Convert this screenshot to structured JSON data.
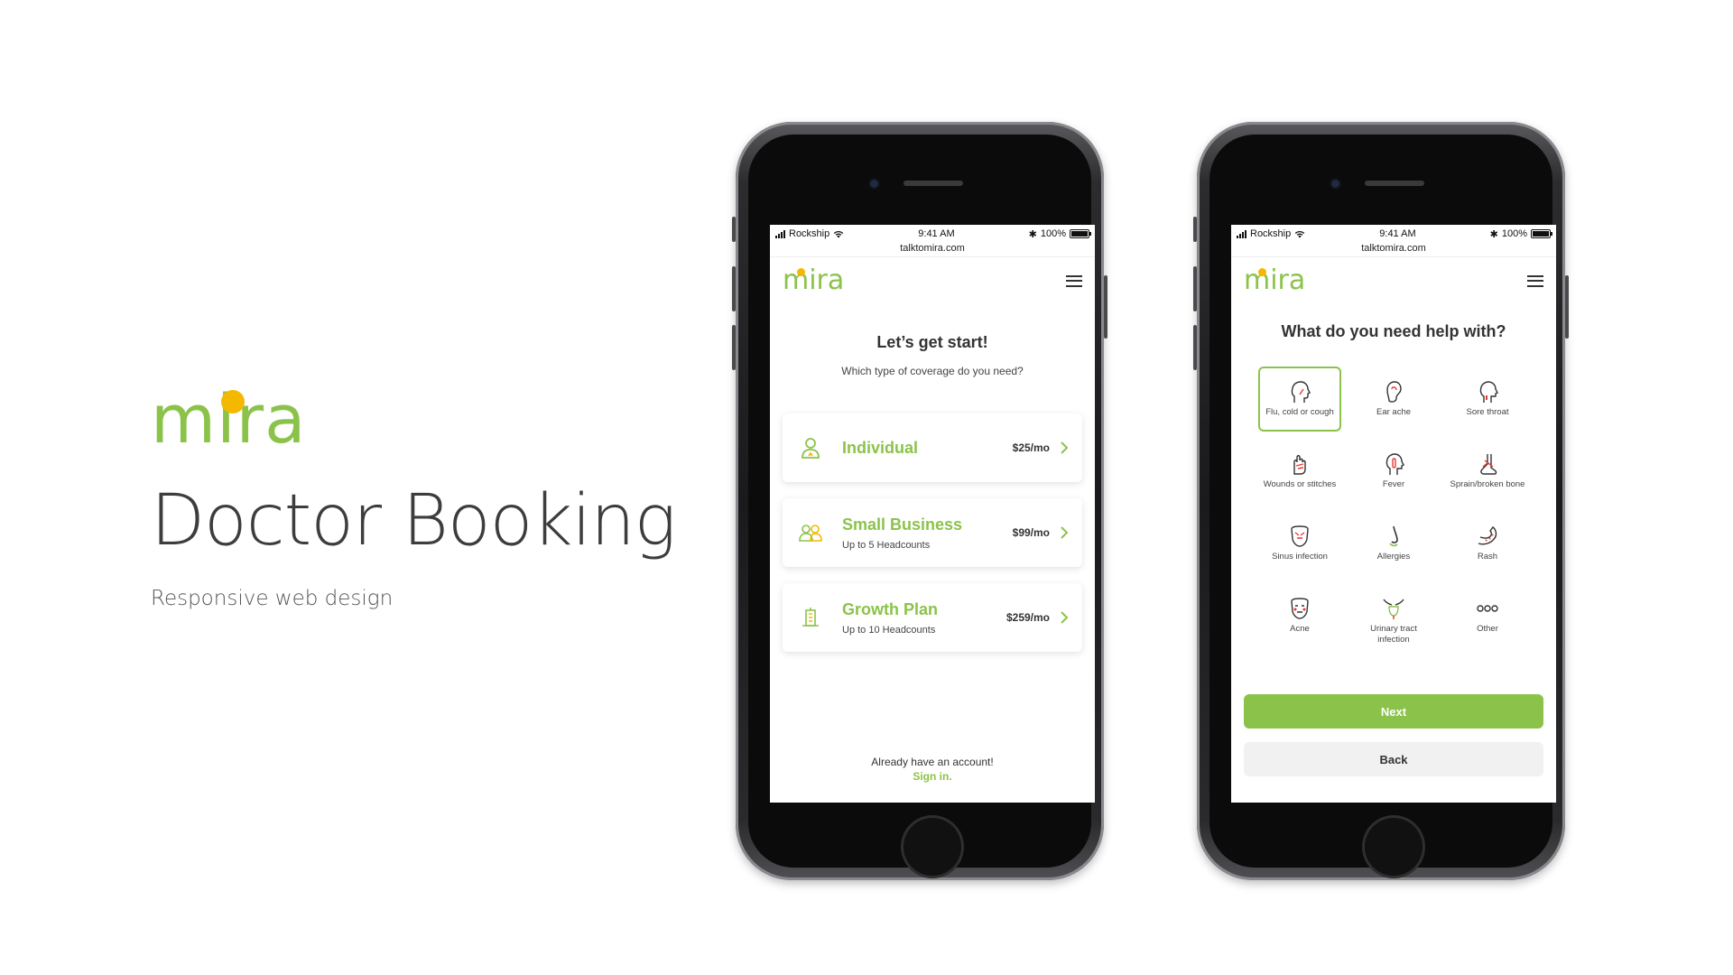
{
  "hero": {
    "logo_text": "mira",
    "title": "Doctor Booking",
    "subtitle": "Responsive web design"
  },
  "colors": {
    "brand_green": "#8bc34a",
    "brand_yellow": "#f5b800"
  },
  "status_bar": {
    "carrier": "Rockship",
    "time": "9:41 AM",
    "battery": "100%",
    "url": "talktomira.com"
  },
  "app": {
    "logo_text": "mira",
    "menu_icon": "hamburger-icon"
  },
  "screen1": {
    "title": "Let’s get start!",
    "subtitle": "Which type of coverage do you need?",
    "plans": [
      {
        "name": "Individual",
        "headcounts": "",
        "price": "$25/mo",
        "icon": "person-icon"
      },
      {
        "name": "Small Business",
        "headcounts": "Up to 5 Headcounts",
        "price": "$99/mo",
        "icon": "group-icon"
      },
      {
        "name": "Growth Plan",
        "headcounts": "Up to 10 Headcounts",
        "price": "$259/mo",
        "icon": "building-icon"
      }
    ],
    "footer_question": "Already have an account!",
    "footer_link": "Sign in."
  },
  "screen2": {
    "title": "What do you need help with?",
    "symptoms": [
      {
        "label": "Flu, cold or cough",
        "icon": "head-icon",
        "selected": true
      },
      {
        "label": "Ear ache",
        "icon": "ear-icon",
        "selected": false
      },
      {
        "label": "Sore throat",
        "icon": "throat-icon",
        "selected": false
      },
      {
        "label": "Wounds or stitches",
        "icon": "bandage-icon",
        "selected": false
      },
      {
        "label": "Fever",
        "icon": "thermometer-icon",
        "selected": false
      },
      {
        "label": "Sprain/broken bone",
        "icon": "foot-icon",
        "selected": false
      },
      {
        "label": "Sinus infection",
        "icon": "face-sinus-icon",
        "selected": false
      },
      {
        "label": "Allergies",
        "icon": "nose-icon",
        "selected": false
      },
      {
        "label": "Rash",
        "icon": "arm-rash-icon",
        "selected": false
      },
      {
        "label": "Acne",
        "icon": "face-acne-icon",
        "selected": false
      },
      {
        "label": "Urinary tract infection",
        "icon": "urinary-icon",
        "selected": false
      },
      {
        "label": "Other",
        "icon": "dots-icon",
        "selected": false
      }
    ],
    "next_label": "Next",
    "back_label": "Back"
  }
}
